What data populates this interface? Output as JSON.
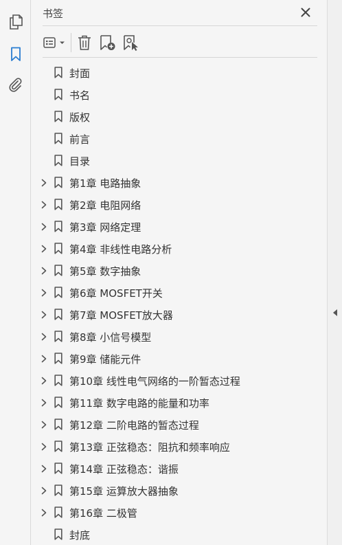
{
  "panel": {
    "title": "书签",
    "toolbar": {
      "options_icon": "list-options-icon",
      "delete_icon": "trash-icon",
      "new_bookmark_icon": "bookmark-add-icon",
      "new_from_selection_icon": "bookmark-select-icon"
    }
  },
  "rail": {
    "items": [
      {
        "name": "pages",
        "icon": "pages-icon"
      },
      {
        "name": "bookmarks",
        "icon": "bookmark-icon",
        "active": true
      },
      {
        "name": "attachments",
        "icon": "paperclip-icon"
      }
    ]
  },
  "bookmarks": [
    {
      "label": "封面",
      "expandable": false
    },
    {
      "label": "书名",
      "expandable": false
    },
    {
      "label": "版权",
      "expandable": false
    },
    {
      "label": "前言",
      "expandable": false
    },
    {
      "label": "目录",
      "expandable": false
    },
    {
      "label": "第1章  电路抽象",
      "expandable": true
    },
    {
      "label": "第2章  电阻网络",
      "expandable": true
    },
    {
      "label": "第3章  网络定理",
      "expandable": true
    },
    {
      "label": "第4章  非线性电路分析",
      "expandable": true
    },
    {
      "label": "第5章  数字抽象",
      "expandable": true
    },
    {
      "label": "第6章  MOSFET开关",
      "expandable": true
    },
    {
      "label": "第7章  MOSFET放大器",
      "expandable": true
    },
    {
      "label": "第8章  小信号模型",
      "expandable": true
    },
    {
      "label": "第9章  储能元件",
      "expandable": true
    },
    {
      "label": "第10章  线性电气网络的一阶暂态过程",
      "expandable": true
    },
    {
      "label": "第11章  数字电路的能量和功率",
      "expandable": true
    },
    {
      "label": "第12章  二阶电路的暂态过程",
      "expandable": true
    },
    {
      "label": "第13章  正弦稳态：阻抗和频率响应",
      "expandable": true
    },
    {
      "label": "第14章  正弦稳态：谐振",
      "expandable": true
    },
    {
      "label": "第15章  运算放大器抽象",
      "expandable": true
    },
    {
      "label": "第16章  二极管",
      "expandable": true
    },
    {
      "label": "封底",
      "expandable": false
    }
  ],
  "colors": {
    "accent": "#2a7dd1",
    "icon": "#555555",
    "text": "#333333"
  }
}
